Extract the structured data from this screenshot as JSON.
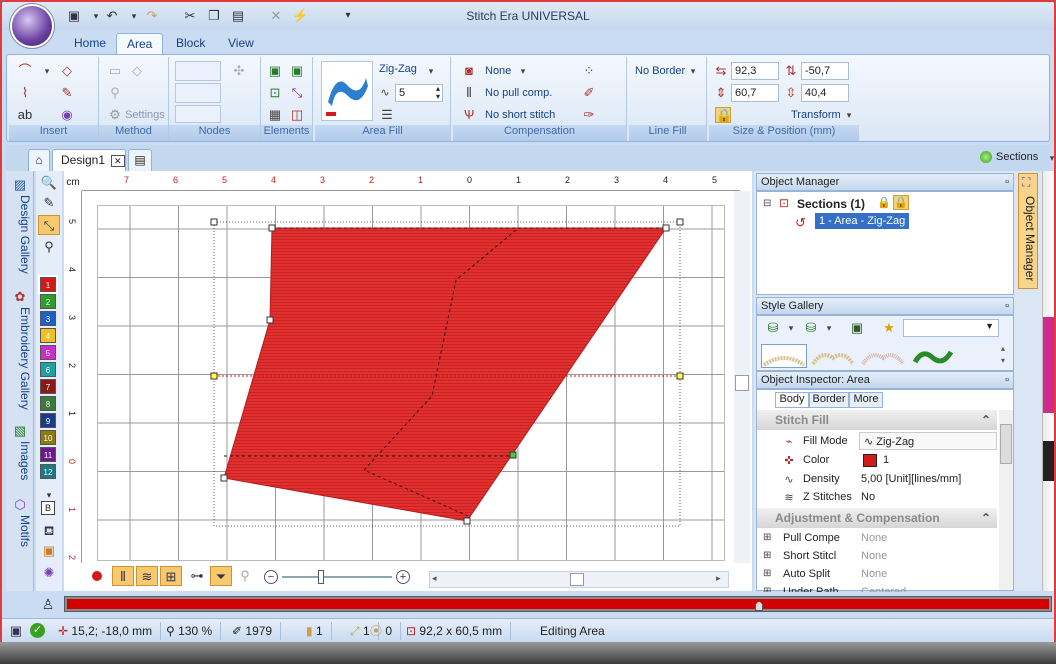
{
  "app": {
    "title": "Stitch Era UNIVERSAL"
  },
  "colors": {
    "accent": "#d21a1a",
    "ribbon": "#dbe7f6",
    "frame": "#e23b3b"
  },
  "tabs": [
    "Home",
    "Area",
    "Block",
    "View"
  ],
  "active_tab": "Area",
  "groups": {
    "insert": "Insert",
    "method": "Method",
    "nodes": "Nodes",
    "elements": "Elements",
    "area_fill": "Area Fill",
    "compensation": "Compensation",
    "line_fill": "Line Fill",
    "size_position": "Size & Position (mm)"
  },
  "method": {
    "settings": "Settings"
  },
  "area_fill": {
    "mode": "Zig-Zag",
    "density": "5"
  },
  "compensation": {
    "pull_preset": "None",
    "pull": "No pull comp.",
    "short": "No short stitch"
  },
  "line_fill": {
    "border": "No Border"
  },
  "size": {
    "x": "92,3",
    "y": "-50,7",
    "w": "60,7",
    "h": "40,4",
    "transform": "Transform"
  },
  "doc": {
    "tab": "Design1",
    "sections": "Sections"
  },
  "left_tabs": [
    "Design Gallery",
    "Embroidery Gallery",
    "Images",
    "Motifs"
  ],
  "palette": [
    "1",
    "2",
    "3",
    "4",
    "5",
    "6",
    "7",
    "8",
    "9",
    "10",
    "11",
    "12"
  ],
  "palette_colors": [
    "#d21a1a",
    "#2e9d2e",
    "#1f5fc8",
    "#f0c020",
    "#c830c8",
    "#20a0a0",
    "#8a1a1a",
    "#3a7a3a",
    "#1a3a8a",
    "#8a7a10",
    "#6a1a8a",
    "#1a7a8a"
  ],
  "palette_extra": "B",
  "ruler": {
    "unit": "cm",
    "h": [
      "7",
      "6",
      "5",
      "4",
      "3",
      "2",
      "1",
      "0",
      "1",
      "2",
      "3",
      "4",
      "5"
    ],
    "v": [
      "5",
      "4",
      "3",
      "2",
      "1",
      "0",
      "1",
      "2"
    ]
  },
  "panels": {
    "object_manager": {
      "title": "Object Manager",
      "root": "Sections (1)",
      "item": "1 - Area - Zig-Zag"
    },
    "style_gallery": {
      "title": "Style Gallery"
    },
    "inspector": {
      "title": "Object Inspector: Area",
      "tabs": [
        "Body",
        "Border",
        "More"
      ],
      "stitch_fill": "Stitch Fill",
      "rows": [
        {
          "label": "Fill Mode",
          "value": "Zig-Zag"
        },
        {
          "label": "Color",
          "value": "1"
        },
        {
          "label": "Density",
          "value": "5,00 [Unit][lines/mm]"
        },
        {
          "label": "Z Stitches",
          "value": "No"
        }
      ],
      "adjust": "Adjustment & Compensation",
      "adj_rows": [
        {
          "label": "Pull Compe",
          "value": "None"
        },
        {
          "label": "Short Stitcl",
          "value": "None"
        },
        {
          "label": "Auto Split",
          "value": "None"
        },
        {
          "label": "Under Path",
          "value": "Centered"
        }
      ]
    }
  },
  "status": {
    "coords": "15,2; -18,0 mm",
    "zoom": "130 %",
    "stitches": "1979",
    "objects": "1",
    "selected": "1",
    "zero": "0",
    "dims": "92,2 x 60,5 mm",
    "mode": "Editing Area"
  }
}
